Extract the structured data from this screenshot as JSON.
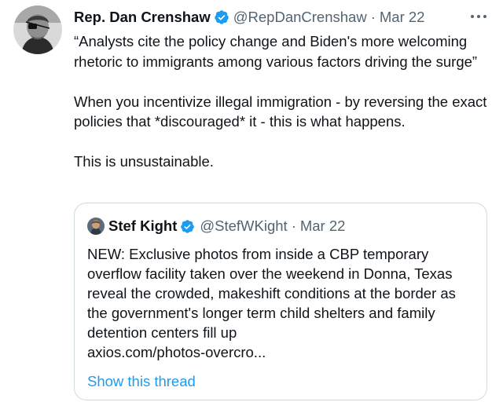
{
  "tweet": {
    "author_name": "Rep. Dan Crenshaw",
    "handle": "@RepDanCrenshaw",
    "separator": "·",
    "date": "Mar 22",
    "paragraphs": [
      "“Analysts cite the policy change and Biden's more welcoming rhetoric to immigrants among various factors driving the surge”",
      "When you incentivize illegal immigration - by reversing the exact policies that *discouraged* it - this is what happens.",
      "This is unsustainable."
    ],
    "icons": {
      "verified": "verified-badge-icon",
      "more": "more-options-icon",
      "avatar": "profile-avatar"
    }
  },
  "quoted": {
    "author_name": "Stef Kight",
    "handle": "@StefWKight",
    "separator": "·",
    "date": "Mar 22",
    "text": "NEW: Exclusive photos from inside a CBP temporary overflow facility taken over the weekend in Donna, Texas reveal the crowded, makeshift conditions at the border as the government's longer term child shelters and family detention centers fill up",
    "link": "axios.com/photos-overcro...",
    "show_thread": "Show this thread"
  },
  "colors": {
    "text": "#0f1419",
    "secondary": "#536471",
    "accent": "#1d9bf0",
    "border": "#cfd9de"
  }
}
